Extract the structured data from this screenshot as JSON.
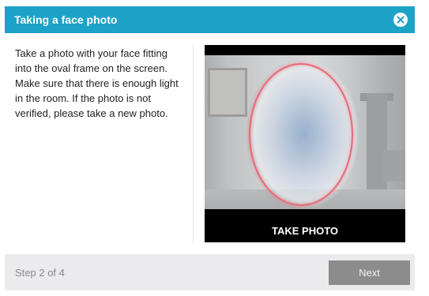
{
  "dialog": {
    "title": "Taking a face photo",
    "close_icon": "close-circle-icon"
  },
  "instructions": "Take a photo with your face fitting into the oval frame on the screen. Make sure that there is enough light in the room. If the photo is not verified, please take a new photo.",
  "camera": {
    "take_photo_label": "TAKE PHOTO",
    "oval_color": "#e86a78"
  },
  "footer": {
    "step_text": "Step 2 of 4",
    "next_label": "Next"
  },
  "colors": {
    "header_bg": "#1da2c8",
    "footer_bg": "#ebebee",
    "next_button_bg": "#8c8c8c"
  }
}
